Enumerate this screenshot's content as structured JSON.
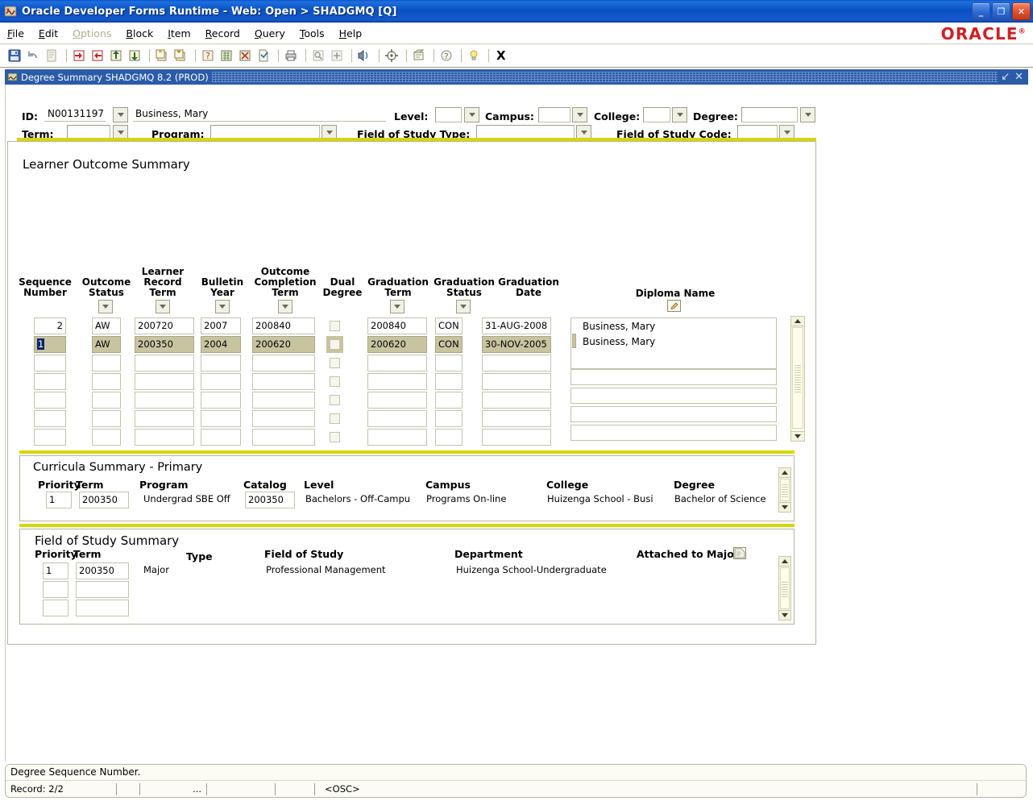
{
  "window": {
    "title": "Oracle Developer Forms Runtime - Web:  Open > SHADGMQ [Q]",
    "minimize": "_",
    "maximize": "❐",
    "close": "✕"
  },
  "menubar": {
    "items": [
      {
        "label": "File",
        "disabled": false
      },
      {
        "label": "Edit",
        "disabled": false
      },
      {
        "label": "Options",
        "disabled": true
      },
      {
        "label": "Block",
        "disabled": false
      },
      {
        "label": "Item",
        "disabled": false
      },
      {
        "label": "Record",
        "disabled": false
      },
      {
        "label": "Query",
        "disabled": false
      },
      {
        "label": "Tools",
        "disabled": false
      },
      {
        "label": "Help",
        "disabled": false
      }
    ],
    "brand": "ORACLE"
  },
  "toolbar": {
    "exit_label": "X",
    "icons": [
      "save-icon",
      "undo-icon",
      "copy-icon",
      "sep",
      "rollback-icon",
      "enter-query-icon",
      "insert-record-icon",
      "remove-record-icon",
      "sep",
      "previous-block-icon",
      "next-block-icon",
      "sep",
      "enter-query-help-icon",
      "execute-query-icon",
      "cancel-query-icon",
      "select-icon",
      "sep",
      "print-icon",
      "sep",
      "search-icon",
      "add-icon",
      "sep",
      "clear-icon",
      "sep",
      "display-error-icon",
      "sep",
      "rollback-form-icon",
      "sep",
      "help-icon",
      "sep",
      "hint-icon",
      "sep"
    ]
  },
  "form": {
    "title": "Degree Summary  SHADGMQ  8.2  (PROD)",
    "restore": "↙",
    "close": "✕"
  },
  "keyblock": {
    "id_label": "ID:",
    "id_value": "N00131197",
    "name_value": "Business, Mary",
    "level_label": "Level:",
    "level_value": "",
    "campus_label": "Campus:",
    "campus_value": "",
    "college_label": "College:",
    "college_value": "",
    "degree_label": "Degree:",
    "degree_value": "",
    "term_label": "Term:",
    "term_value": "",
    "program_label": "Program:",
    "program_value": "",
    "fos_type_label": "Field of Study Type:",
    "fos_type_value": "",
    "fos_code_label": "Field of Study Code:",
    "fos_code_value": ""
  },
  "learner_outcome": {
    "title": "Learner Outcome Summary",
    "columns": [
      {
        "label": "Sequence\nNumber",
        "lov": false
      },
      {
        "label": "Outcome\nStatus",
        "lov": true
      },
      {
        "label": "Learner\nRecord\nTerm",
        "lov": true
      },
      {
        "label": "Bulletin\nYear",
        "lov": true
      },
      {
        "label": "Outcome\nCompletion\nTerm",
        "lov": true
      },
      {
        "label": "Dual\nDegree",
        "lov": false
      },
      {
        "label": "Graduation\nTerm",
        "lov": true
      },
      {
        "label": "Graduation\nStatus",
        "lov": true
      },
      {
        "label": "Graduation\nDate",
        "lov": false
      },
      {
        "label": "Diploma Name",
        "lov": false
      }
    ],
    "rows": [
      {
        "sequence": "2",
        "status": "AW",
        "record_term": "200720",
        "bulletin_year": "2007",
        "completion_term": "200840",
        "dual_degree": false,
        "grad_term": "200840",
        "grad_status": "CON",
        "grad_date": "31-AUG-2008",
        "diploma_name": "Business, Mary",
        "selected": false
      },
      {
        "sequence": "1",
        "status": "AW",
        "record_term": "200350",
        "bulletin_year": "2004",
        "completion_term": "200620",
        "dual_degree": false,
        "grad_term": "200620",
        "grad_status": "CON",
        "grad_date": "30-NOV-2005",
        "diploma_name": "Business, Mary",
        "selected": true
      },
      {
        "sequence": "",
        "status": "",
        "record_term": "",
        "bulletin_year": "",
        "completion_term": "",
        "dual_degree": false,
        "grad_term": "",
        "grad_status": "",
        "grad_date": "",
        "diploma_name": "",
        "selected": false
      },
      {
        "sequence": "",
        "status": "",
        "record_term": "",
        "bulletin_year": "",
        "completion_term": "",
        "dual_degree": false,
        "grad_term": "",
        "grad_status": "",
        "grad_date": "",
        "diploma_name": "",
        "selected": false
      },
      {
        "sequence": "",
        "status": "",
        "record_term": "",
        "bulletin_year": "",
        "completion_term": "",
        "dual_degree": false,
        "grad_term": "",
        "grad_status": "",
        "grad_date": "",
        "diploma_name": "",
        "selected": false
      },
      {
        "sequence": "",
        "status": "",
        "record_term": "",
        "bulletin_year": "",
        "completion_term": "",
        "dual_degree": false,
        "grad_term": "",
        "grad_status": "",
        "grad_date": "",
        "diploma_name": "",
        "selected": false
      },
      {
        "sequence": "",
        "status": "",
        "record_term": "",
        "bulletin_year": "",
        "completion_term": "",
        "dual_degree": false,
        "grad_term": "",
        "grad_status": "",
        "grad_date": "",
        "diploma_name": "",
        "selected": false
      }
    ]
  },
  "curricula": {
    "title": "Curricula Summary - Primary",
    "columns": [
      "Priority",
      "Term",
      "Program",
      "Catalog",
      "Level",
      "Campus",
      "College",
      "Degree"
    ],
    "rows": [
      {
        "priority": "1",
        "term": "200350",
        "program": "Undergrad SBE Off",
        "catalog": "200350",
        "level": "Bachelors - Off-Campu",
        "campus": "Programs On-line",
        "college": "Huizenga School - Busi",
        "degree": "Bachelor of Science"
      }
    ]
  },
  "field_of_study": {
    "title": "Field of Study Summary",
    "columns": [
      "Priority",
      "Term",
      "Type",
      "Field of Study",
      "Department",
      "Attached to Major"
    ],
    "rows": [
      {
        "priority": "1",
        "term": "200350",
        "type": "Major",
        "field_of_study": "Professional Management",
        "department": "Huizenga School-Undergraduate",
        "attached": ""
      },
      {
        "priority": "",
        "term": "",
        "type": "",
        "field_of_study": "",
        "department": "",
        "attached": ""
      },
      {
        "priority": "",
        "term": "",
        "type": "",
        "field_of_study": "",
        "department": "",
        "attached": ""
      }
    ]
  },
  "statusbar": {
    "message": "Degree Sequence Number.",
    "record": "Record: 2/2",
    "field2": "",
    "field3": "",
    "ellipsis": "...",
    "field4": "",
    "field5": "",
    "mode": "<OSC>"
  },
  "colors": {
    "title_blue": "#1559cc",
    "form_blue": "#2b5ba8",
    "accent_yellow": "#d6d600",
    "selected_row": "#c8c4a0",
    "oracle_red": "#cf2026",
    "field_border": "#bdbda4"
  }
}
